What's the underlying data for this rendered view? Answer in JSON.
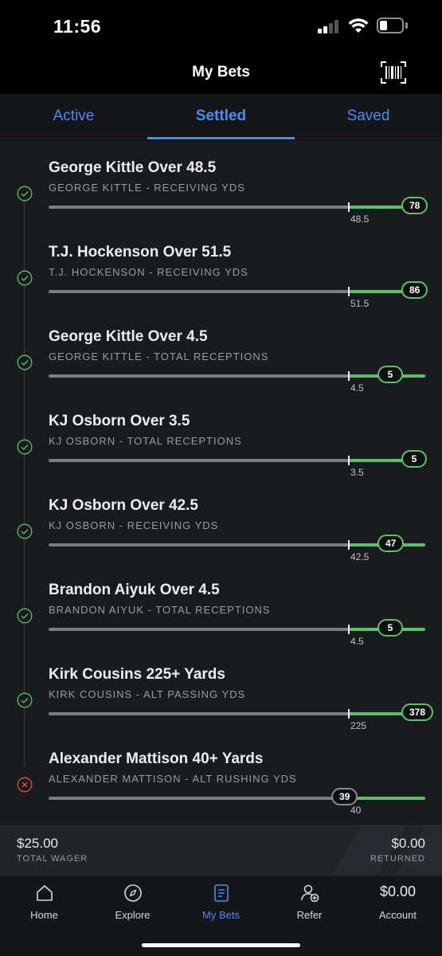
{
  "status_bar": {
    "time": "11:56"
  },
  "header": {
    "title": "My Bets"
  },
  "tabs": [
    {
      "label": "Active",
      "active": false
    },
    {
      "label": "Settled",
      "active": true
    },
    {
      "label": "Saved",
      "active": false
    }
  ],
  "bets": [
    {
      "title": "George Kittle Over 48.5",
      "subtitle": "GEORGE KITTLE - RECEIVING YDS",
      "line": "48.5",
      "result": "78",
      "outcome": "won"
    },
    {
      "title": "T.J. Hockenson Over 51.5",
      "subtitle": "T.J. HOCKENSON - RECEIVING YDS",
      "line": "51.5",
      "result": "86",
      "outcome": "won"
    },
    {
      "title": "George Kittle Over 4.5",
      "subtitle": "GEORGE KITTLE - TOTAL RECEPTIONS",
      "line": "4.5",
      "result": "5",
      "outcome": "won"
    },
    {
      "title": "KJ Osborn Over 3.5",
      "subtitle": "KJ OSBORN - TOTAL RECEPTIONS",
      "line": "3.5",
      "result": "5",
      "outcome": "won"
    },
    {
      "title": "KJ Osborn Over 42.5",
      "subtitle": "KJ OSBORN - RECEIVING YDS",
      "line": "42.5",
      "result": "47",
      "outcome": "won"
    },
    {
      "title": "Brandon Aiyuk Over 4.5",
      "subtitle": "BRANDON AIYUK - TOTAL RECEPTIONS",
      "line": "4.5",
      "result": "5",
      "outcome": "won"
    },
    {
      "title": "Kirk Cousins 225+ Yards",
      "subtitle": "KIRK COUSINS - ALT PASSING YDS",
      "line": "225",
      "result": "378",
      "outcome": "won"
    },
    {
      "title": "Alexander Mattison 40+ Yards",
      "subtitle": "ALEXANDER MATTISON - ALT RUSHING YDS",
      "line": "40",
      "result": "39",
      "outcome": "lost"
    }
  ],
  "summary": {
    "wager_amount": "$25.00",
    "wager_label": "TOTAL WAGER",
    "returned_amount": "$0.00",
    "returned_label": "RETURNED"
  },
  "bottom_nav": {
    "items": [
      {
        "label": "Home",
        "icon": "home-icon"
      },
      {
        "label": "Explore",
        "icon": "compass-icon"
      },
      {
        "label": "My Bets",
        "icon": "betslip-icon",
        "active": true
      },
      {
        "label": "Refer",
        "icon": "add-user-icon"
      },
      {
        "label": "Account",
        "amount": "$0.00"
      }
    ]
  },
  "colors": {
    "accent": "#4a8cf2",
    "win": "#59c26a",
    "loss": "#e0504f",
    "list_bg": "#1a1b1f"
  }
}
